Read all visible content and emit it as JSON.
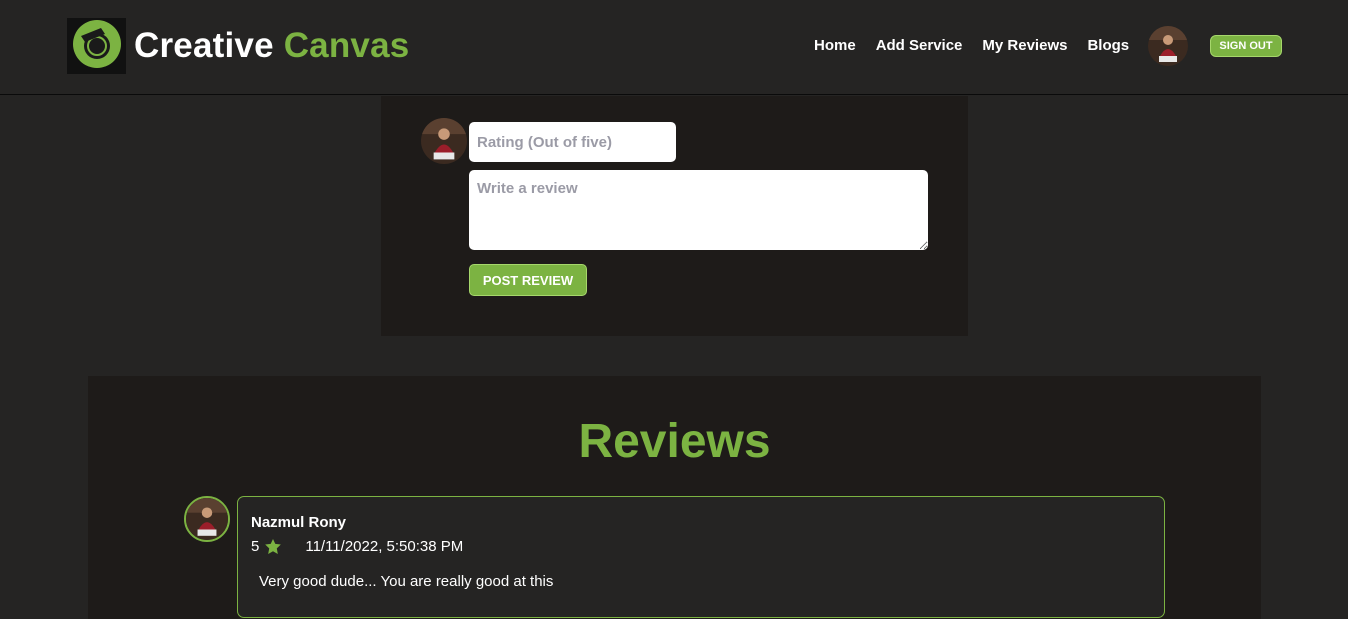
{
  "header": {
    "brand_part1": "Creative",
    "brand_part2": "Canvas",
    "nav": [
      {
        "label": "Home"
      },
      {
        "label": "Add Service"
      },
      {
        "label": "My Reviews"
      },
      {
        "label": "Blogs"
      }
    ],
    "signout_label": "SIGN OUT",
    "logo_icon": "camera-lens-icon"
  },
  "review_form": {
    "rating_placeholder": "Rating (Out of five)",
    "rating_value": "",
    "review_placeholder": "Write a review",
    "review_value": "",
    "post_label": "POST REVIEW"
  },
  "reviews": {
    "title": "Reviews",
    "items": [
      {
        "name": "Nazmul Rony",
        "rating": "5",
        "date": "11/11/2022, 5:50:38 PM",
        "text": "Very good dude... You are really good at this"
      }
    ]
  },
  "colors": {
    "accent": "#7cb342",
    "background": "#252423",
    "panel": "#1e1b19"
  }
}
